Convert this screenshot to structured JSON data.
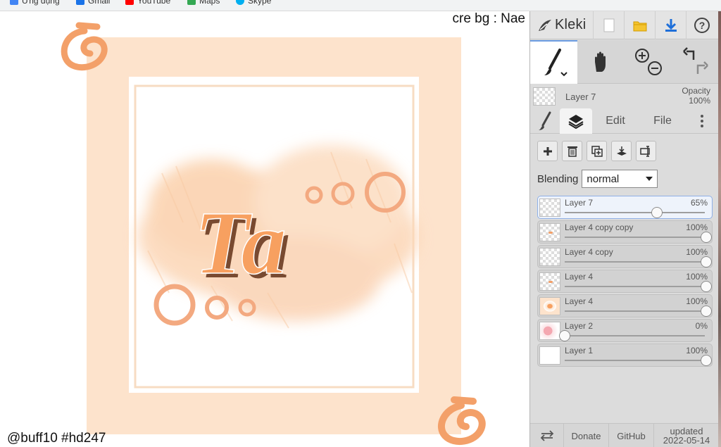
{
  "bookmarks": [
    {
      "label": "Ứng dụng",
      "color": "#4285f4"
    },
    {
      "label": "Gmail",
      "color": "#1a73e8"
    },
    {
      "label": "YouTube",
      "color": "#ff0000"
    },
    {
      "label": "Maps",
      "color": "#34a853"
    },
    {
      "label": "Skype",
      "color": "#00aff0"
    }
  ],
  "canvas": {
    "credit_top": "cre bg : Nae",
    "credit_bottom": "@buff10 #hd247",
    "artwork_text": "Ta",
    "colors": {
      "frame": "#fde3cc",
      "accent": "#f3a069",
      "wash": "#fcd9bd"
    }
  },
  "app": {
    "name": "Kleki",
    "topbar_icons": [
      "new-file-icon",
      "open-folder-icon",
      "download-icon",
      "help-icon"
    ],
    "tools": [
      {
        "name": "brush-tool",
        "active": true
      },
      {
        "name": "hand-tool",
        "active": false
      },
      {
        "name": "zoom-tool",
        "active": false
      },
      {
        "name": "undo-redo-tool",
        "active": false
      }
    ],
    "current_layer": {
      "name": "Layer 7",
      "opacity_label": "Opacity",
      "opacity_value": "100%"
    },
    "tabs": [
      {
        "label": "",
        "icon": "brush-icon"
      },
      {
        "label": "",
        "icon": "layers-icon",
        "active": true
      },
      {
        "label": "Edit"
      },
      {
        "label": "File"
      },
      {
        "label": "",
        "icon": "more-icon"
      }
    ],
    "layer_buttons": [
      "add-layer-icon",
      "delete-layer-icon",
      "duplicate-layer-icon",
      "merge-layer-icon",
      "rename-layer-icon"
    ],
    "blending": {
      "label": "Blending",
      "value": "normal"
    },
    "layers": [
      {
        "name": "Layer 7",
        "opacity": "65%",
        "value": 0.65,
        "active": true,
        "thumb": "empty"
      },
      {
        "name": "Layer 4 copy copy",
        "opacity": "100%",
        "value": 1.0,
        "thumb": "dots"
      },
      {
        "name": "Layer 4 copy",
        "opacity": "100%",
        "value": 1.0,
        "thumb": "empty"
      },
      {
        "name": "Layer 4",
        "opacity": "100%",
        "value": 1.0,
        "thumb": "dots"
      },
      {
        "name": "Layer 4",
        "opacity": "100%",
        "value": 1.0,
        "thumb": "art"
      },
      {
        "name": "Layer 2",
        "opacity": "0%",
        "value": 0.0,
        "thumb": "pink"
      },
      {
        "name": "Layer 1",
        "opacity": "100%",
        "value": 1.0,
        "thumb": "white"
      }
    ],
    "footer": {
      "swap_icon": "swap-arrows-icon",
      "donate": "Donate",
      "github": "GitHub",
      "updated_label": "updated",
      "updated_date": "2022-05-14"
    }
  }
}
